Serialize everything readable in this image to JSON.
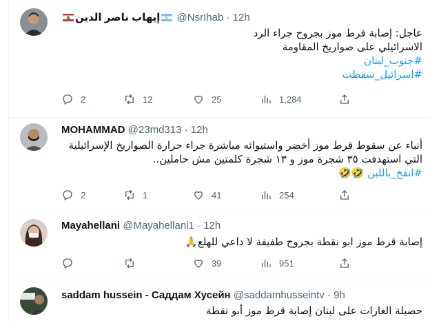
{
  "tweets": [
    {
      "name": "إيهاب ناصر الدين",
      "handle": "@NsrIhab",
      "time": "12h",
      "body_lines": [
        "عاجل: إصابة قرط موز بجروح جراء الرد",
        "الاسرائيلي على صواريخ المقاومة"
      ],
      "hashtags": [
        "#جنوب_لبنان",
        "#اسرائيل_سقطت"
      ],
      "actions": {
        "reply": "2",
        "retweet": "12",
        "like": "25",
        "views": "1,284"
      }
    },
    {
      "name": "MOHAMMAD",
      "handle": "@23md313",
      "time": "12h",
      "body_lines": [
        "أنباء عن سقوط قرط موز أخضر واستيوائه مباشرة جراء حرارة الصواريخ الإسرائيلية",
        "التي استهدفت ٣٥ شجرة موز و ١٣ شجرة كلمتين مش حاملين.."
      ],
      "hashtags": [
        "#انفخ_باللبن 🤣🤣"
      ],
      "actions": {
        "reply": "2",
        "retweet": "1",
        "like": "41",
        "views": "254"
      }
    },
    {
      "name": "Mayahellani",
      "handle": "@Mayahellani1",
      "time": "12h",
      "body_lines": [
        "إصابة قرط موز ابو نقطة بجروح طفيفة لا داعي للهلع🙏"
      ],
      "hashtags": [],
      "actions": {
        "reply": "",
        "retweet": "",
        "like": "39",
        "views": "951"
      }
    },
    {
      "name": "saddam hussein - Саддам Хусейн",
      "handle": "@saddamhusseintv",
      "time": "9h",
      "body_lines": [
        "حصيلة الغارات على لبنان إصابة قرط موز أبو نقطة"
      ],
      "hashtags": [],
      "actions": {
        "reply": "",
        "retweet": "",
        "like": "",
        "views": ""
      }
    }
  ],
  "separator": "·",
  "colors": {
    "link": "#1d9bf0",
    "muted": "#536471",
    "border": "#eff3f4"
  },
  "icons": [
    "reply-icon",
    "retweet-icon",
    "like-icon",
    "views-icon",
    "share-icon"
  ]
}
